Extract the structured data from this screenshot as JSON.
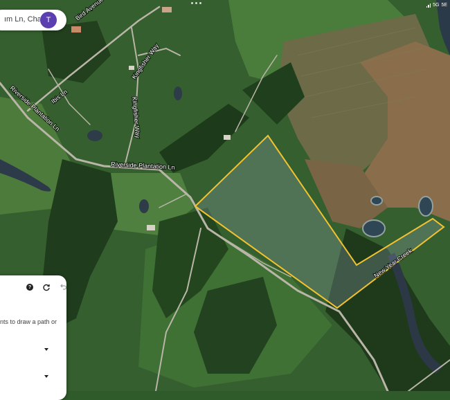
{
  "status_bar": {
    "network": "5G",
    "extra": "5E"
  },
  "search": {
    "query": "ım Ln, Chappell I",
    "avatar_letter": "T"
  },
  "panel": {
    "hint_text": "nts to draw a path or"
  },
  "roads": [
    {
      "name": "Riverside Plantation Ln"
    },
    {
      "name": "Riverside Plantation Ln"
    },
    {
      "name": "Kingfisher Way"
    },
    {
      "name": "Kingfisher Way"
    },
    {
      "name": "Ibis Ln"
    },
    {
      "name": "New Year Creek"
    },
    {
      "name": "Bird Avenue"
    }
  ],
  "colors": {
    "parcel_outline": "#f2c230",
    "search_avatar": "#5b3fb0",
    "forest": "#1f3d1c",
    "field": "#3e6b33"
  },
  "icons": [
    "help-icon",
    "redo-icon",
    "undo-icon",
    "dropdown-caret-icon"
  ]
}
